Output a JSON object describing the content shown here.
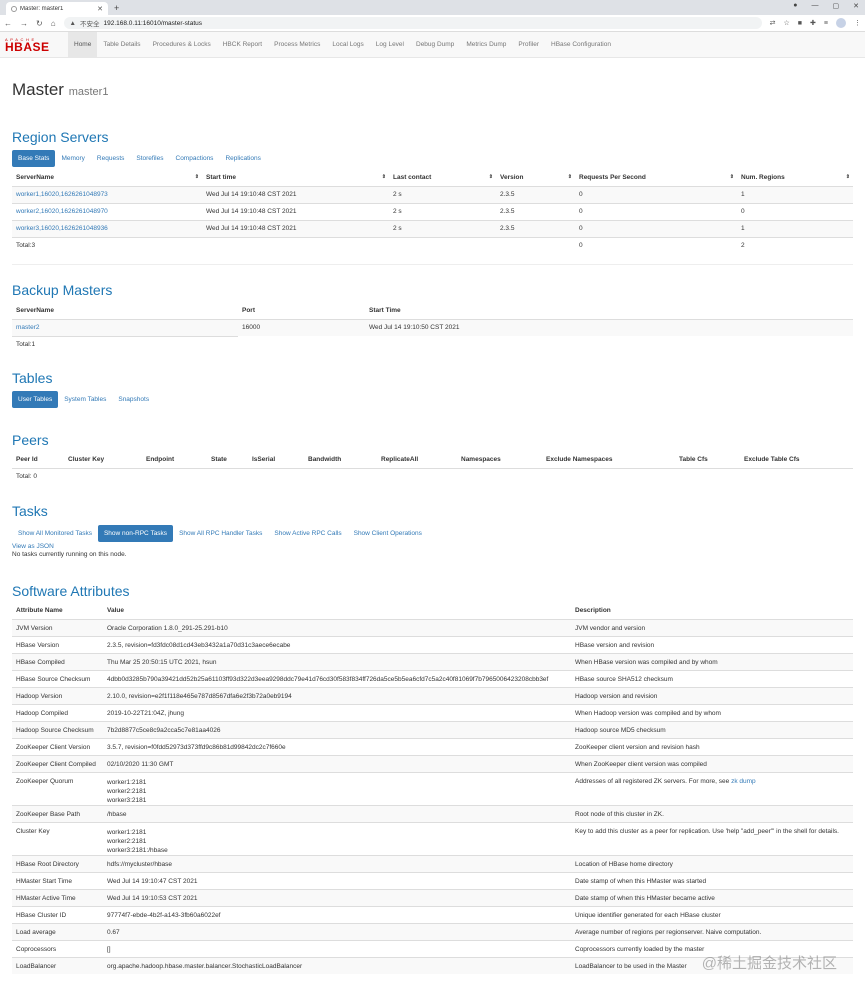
{
  "browser": {
    "tab_title": "Master: master1",
    "security_label": "不安全",
    "url": "192.168.0.11:16010/master-status"
  },
  "logo": {
    "top": "APACHE",
    "main": "HBASE"
  },
  "nav": [
    "Home",
    "Table Details",
    "Procedures & Locks",
    "HBCK Report",
    "Process Metrics",
    "Local Logs",
    "Log Level",
    "Debug Dump",
    "Metrics Dump",
    "Profiler",
    "HBase Configuration"
  ],
  "page": {
    "title": "Master",
    "subtitle": "master1"
  },
  "region_servers": {
    "heading": "Region Servers",
    "pills": [
      "Base Stats",
      "Memory",
      "Requests",
      "Storefiles",
      "Compactions",
      "Replications"
    ],
    "columns": [
      "ServerName",
      "Start time",
      "Last contact",
      "Version",
      "Requests Per Second",
      "Num. Regions"
    ],
    "rows": [
      [
        "worker1,16020,1626261048973",
        "Wed Jul 14 19:10:48 CST 2021",
        "2 s",
        "2.3.5",
        "0",
        "1"
      ],
      [
        "worker2,16020,1626261048970",
        "Wed Jul 14 19:10:48 CST 2021",
        "2 s",
        "2.3.5",
        "0",
        "0"
      ],
      [
        "worker3,16020,1626261048936",
        "Wed Jul 14 19:10:48 CST 2021",
        "2 s",
        "2.3.5",
        "0",
        "1"
      ]
    ],
    "total": [
      "Total:3",
      "",
      "",
      "",
      "0",
      "2"
    ]
  },
  "backup_masters": {
    "heading": "Backup Masters",
    "columns": [
      "ServerName",
      "Port",
      "Start Time"
    ],
    "rows": [
      [
        "master2",
        "16000",
        "Wed Jul 14 19:10:50 CST 2021"
      ]
    ],
    "total": "Total:1"
  },
  "tables": {
    "heading": "Tables",
    "pills": [
      "User Tables",
      "System Tables",
      "Snapshots"
    ]
  },
  "peers": {
    "heading": "Peers",
    "columns": [
      "Peer Id",
      "Cluster Key",
      "Endpoint",
      "State",
      "IsSerial",
      "Bandwidth",
      "ReplicateAll",
      "Namespaces",
      "Exclude Namespaces",
      "Table Cfs",
      "Exclude Table Cfs"
    ],
    "total": "Total: 0"
  },
  "tasks": {
    "heading": "Tasks",
    "pills": [
      "Show All Monitored Tasks",
      "Show non-RPC Tasks",
      "Show All RPC Handler Tasks",
      "Show Active RPC Calls",
      "Show Client Operations"
    ],
    "view_json": "View as JSON",
    "none": "No tasks currently running on this node."
  },
  "software": {
    "heading": "Software Attributes",
    "columns": [
      "Attribute Name",
      "Value",
      "Description"
    ],
    "rows": [
      [
        "JVM Version",
        "Oracle Corporation 1.8.0_291-25.291-b10",
        "JVM vendor and version"
      ],
      [
        "HBase Version",
        "2.3.5, revision=fd3fdc08d1cd43eb3432a1a70d31c3aece6ecabe",
        "HBase version and revision"
      ],
      [
        "HBase Compiled",
        "Thu Mar 25 20:50:15 UTC 2021, hsun",
        "When HBase version was compiled and by whom"
      ],
      [
        "HBase Source Checksum",
        "4dbb0d3285b790a39421dd52b25a61103ff93d322d3eea9298ddc79e41d76cd30f583f834ff726da5ce5b5ea6cfd7c5a2c40f81069f7b7965006423208cbb3ef",
        "HBase source SHA512 checksum"
      ],
      [
        "Hadoop Version",
        "2.10.0, revision=e2f1f118e465e787d8567dfa6e2f3b72a0eb9194",
        "Hadoop version and revision"
      ],
      [
        "Hadoop Compiled",
        "2019-10-22T21:04Z, jhung",
        "When Hadoop version was compiled and by whom"
      ],
      [
        "Hadoop Source Checksum",
        "7b2d8877c5ce8c9a2cca5c7e81aa4026",
        "Hadoop source MD5 checksum"
      ],
      [
        "ZooKeeper Client Version",
        "3.5.7, revision=f0fdd52973d373ffd9c86b81d99842dc2c7f660e",
        "ZooKeeper client version and revision hash"
      ],
      [
        "ZooKeeper Client Compiled",
        "02/10/2020 11:30 GMT",
        "When ZooKeeper client version was compiled"
      ],
      [
        "ZooKeeper Quorum",
        "worker1:2181\nworker2:2181\nworker3:2181",
        "Addresses of all registered ZK servers. For more, see "
      ],
      [
        "ZooKeeper Base Path",
        "/hbase",
        "Root node of this cluster in ZK."
      ],
      [
        "Cluster Key",
        "worker1:2181\nworker2:2181\nworker3:2181:/hbase",
        "Key to add this cluster as a peer for replication. Use 'help \"add_peer\"' in the shell for details."
      ],
      [
        "HBase Root Directory",
        "hdfs://mycluster/hbase",
        "Location of HBase home directory"
      ],
      [
        "HMaster Start Time",
        "Wed Jul 14 19:10:47 CST 2021",
        "Date stamp of when this HMaster was started"
      ],
      [
        "HMaster Active Time",
        "Wed Jul 14 19:10:53 CST 2021",
        "Date stamp of when this HMaster became active"
      ],
      [
        "HBase Cluster ID",
        "97774f7-ebde-4b2f-a143-3fb60a6022ef",
        "Unique identifier generated for each HBase cluster"
      ],
      [
        "Load average",
        "0.67",
        "Average number of regions per regionserver. Naive computation."
      ],
      [
        "Coprocessors",
        "[]",
        "Coprocessors currently loaded by the master"
      ],
      [
        "LoadBalancer",
        "org.apache.hadoop.hbase.master.balancer.StochasticLoadBalancer",
        "LoadBalancer to be used in the Master"
      ]
    ],
    "zk_link": "zk dump"
  },
  "watermark": "@稀土掘金技术社区"
}
